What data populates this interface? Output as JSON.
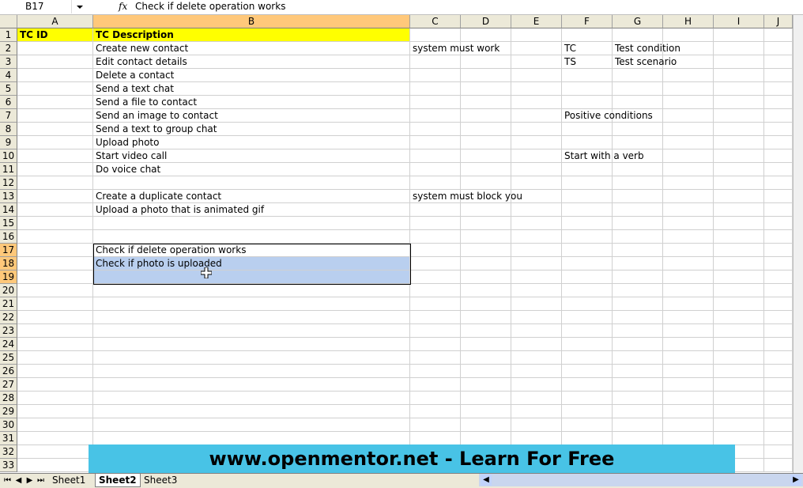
{
  "formula_bar": {
    "name_box": "B17",
    "fx_label": "fx",
    "formula": "Check if delete operation works"
  },
  "columns": [
    "A",
    "B",
    "C",
    "D",
    "E",
    "F",
    "G",
    "H",
    "I",
    "J"
  ],
  "rows": [
    "1",
    "2",
    "3",
    "4",
    "5",
    "6",
    "7",
    "8",
    "9",
    "10",
    "11",
    "12",
    "13",
    "14",
    "15",
    "16",
    "17",
    "18",
    "19",
    "20",
    "21",
    "22",
    "23",
    "24",
    "25",
    "26",
    "27",
    "28",
    "29",
    "30",
    "31",
    "32",
    "33"
  ],
  "cells": {
    "A1": "TC ID",
    "B1": "TC Description",
    "B2": "Create new contact",
    "B3": "Edit contact details",
    "B4": "Delete a contact",
    "B5": "Send a text chat",
    "B6": "Send a file to contact",
    "B7": "Send an image to contact",
    "B8": "Send a text to group chat",
    "B9": "Upload photo",
    "B10": "Start video call",
    "B11": "Do voice chat",
    "B13": "Create a duplicate contact",
    "B14": "Upload a photo that is animated gif",
    "B17": "Check if delete operation works",
    "B18": "Check if photo is uploaded",
    "C2": "system must work",
    "C13": "system must block you",
    "F2": "TC",
    "G2": "Test condition",
    "F3": "TS",
    "G3": "Test scenario",
    "F7": "Positive conditions",
    "F10": "Start with a verb"
  },
  "banner": "www.openmentor.net   -   Learn For Free",
  "sheet_tabs": [
    {
      "label": "Sheet1",
      "active": false
    },
    {
      "label": "Sheet2",
      "active": true
    },
    {
      "label": "Sheet3",
      "active": false
    }
  ],
  "colors": {
    "header_fill": "#ffff00",
    "selection_fill": "#b9cfef",
    "banner_fill": "#48c3e6"
  }
}
